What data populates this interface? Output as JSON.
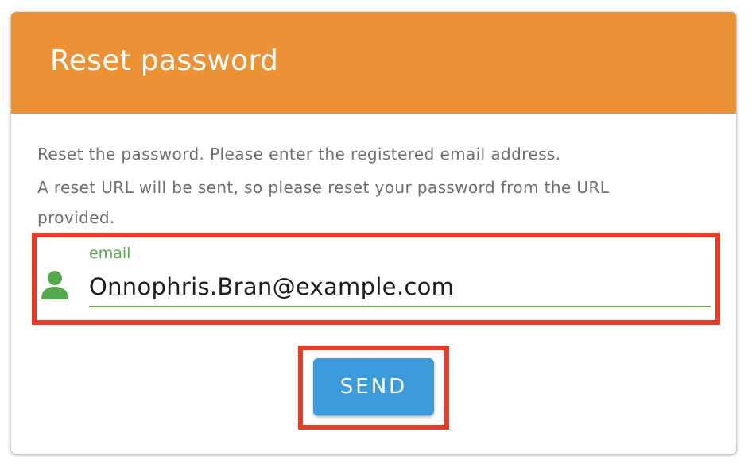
{
  "dialog": {
    "title": "Reset password",
    "description": {
      "line1": "Reset the password. Please enter the registered email address.",
      "line2a": "A reset URL will be sent, so please reset your password from the URL",
      "line2b": "provided."
    }
  },
  "email_field": {
    "label": "email",
    "value": "Onnophris.Bran@example.com",
    "icon": "person-icon"
  },
  "send_button": {
    "label": "SEND"
  },
  "colors": {
    "header": "#ec9236",
    "accent_green": "#55a84d",
    "button": "#3b9bdb",
    "highlight": "#e83a25"
  }
}
